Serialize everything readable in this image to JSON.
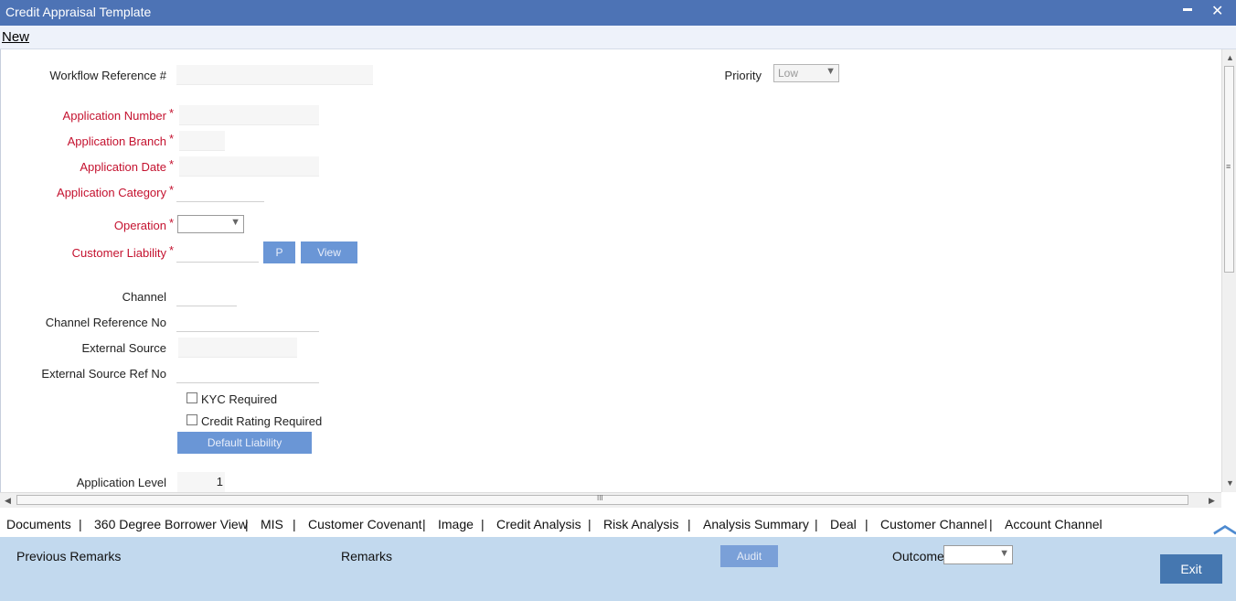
{
  "window": {
    "title": "Credit Appraisal Template",
    "minimize": "▬",
    "close": "✕"
  },
  "menu": {
    "new_label": "New"
  },
  "form": {
    "workflow_ref_label": "Workflow Reference #",
    "priority_label": "Priority",
    "priority_value": "Low",
    "application_number_label": "Application Number",
    "application_branch_label": "Application Branch",
    "application_date_label": "Application Date",
    "application_category_label": "Application Category",
    "operation_label": "Operation",
    "customer_liability_label": "Customer Liability",
    "p_button": "P",
    "view_button": "View",
    "channel_label": "Channel",
    "channel_ref_label": "Channel Reference No",
    "external_source_label": "External Source",
    "external_source_ref_label": "External Source Ref No",
    "kyc_label": "KYC Required",
    "credit_rating_label": "Credit Rating Required",
    "default_liability_button": "Default Liability",
    "application_level_label": "Application Level",
    "application_level_value": "1",
    "required_mark": "*"
  },
  "scroll": {
    "grip": "≡",
    "hgrip": "III",
    "up": "▲",
    "down": "▼",
    "left": "◀",
    "right": "▶"
  },
  "tabs": [
    "Documents",
    "360 Degree Borrower View",
    "MIS",
    "Customer Covenant",
    "Image",
    "Credit Analysis",
    "Risk Analysis",
    "Analysis Summary",
    "Deal",
    "Customer Channel",
    "Account Channel"
  ],
  "tab_separator": "|",
  "footer": {
    "previous_remarks": "Previous Remarks",
    "remarks": "Remarks",
    "audit": "Audit",
    "outcome": "Outcome",
    "exit": "Exit",
    "collapse_glyph": "︿"
  },
  "colors": {
    "title_bar": "#4d73b5",
    "required": "#c4122f",
    "button": "#6a96d6",
    "footer": "#c2d9ee",
    "exit_button": "#4577b0"
  }
}
